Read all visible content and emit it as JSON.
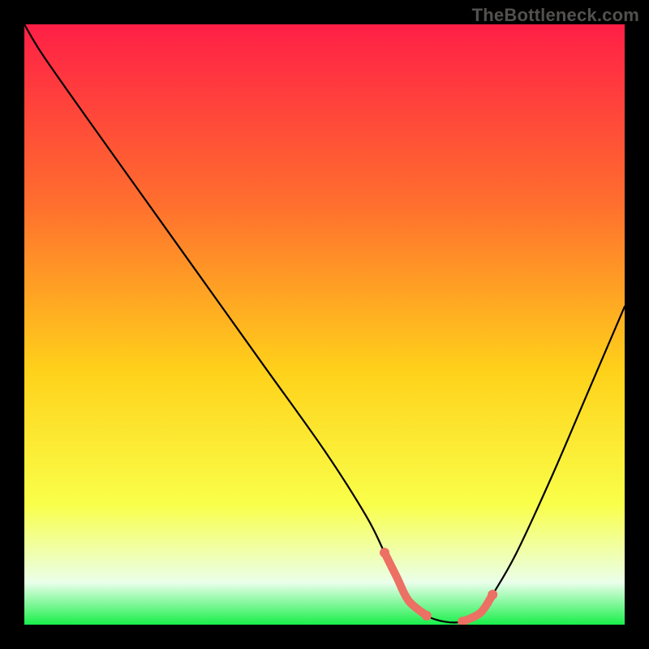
{
  "watermark": "TheBottleneck.com",
  "colors": {
    "gradient_top": "#ff1f46",
    "gradient_upper_mid": "#ff6f2e",
    "gradient_mid": "#ffd21a",
    "gradient_lower_mid": "#f9ff4a",
    "gradient_low": "#eaffea",
    "gradient_bottom": "#19ef4a",
    "curve": "#000000",
    "highlight": "#ec7063"
  },
  "chart_data": {
    "type": "line",
    "title": "",
    "xlabel": "",
    "ylabel": "",
    "xlim": [
      0,
      100
    ],
    "ylim": [
      0,
      100
    ],
    "series": [
      {
        "name": "bottleneck-curve",
        "x": [
          0,
          3,
          10,
          20,
          30,
          40,
          50,
          57,
          60,
          62,
          64,
          67,
          70,
          73,
          76,
          78,
          82,
          88,
          94,
          100
        ],
        "y": [
          100,
          95,
          85,
          71,
          57,
          43,
          29,
          18,
          12,
          8,
          4,
          1.5,
          0.5,
          0.5,
          2,
          5,
          12,
          25,
          39,
          53
        ]
      }
    ],
    "highlight_segments": [
      {
        "x": [
          60,
          62,
          64,
          67
        ],
        "y": [
          12,
          8,
          4,
          1.5
        ]
      },
      {
        "x": [
          73,
          76,
          78
        ],
        "y": [
          0.5,
          2,
          5
        ]
      }
    ]
  }
}
